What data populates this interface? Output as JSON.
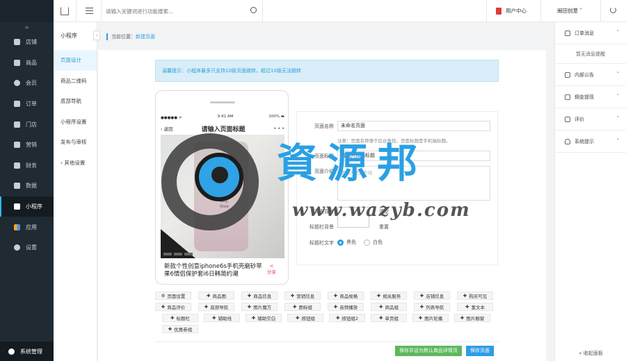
{
  "leftnav": {
    "collapse_icon": "≡",
    "items": [
      {
        "label": "店铺",
        "icon": "store-icon"
      },
      {
        "label": "商品",
        "icon": "goods-icon"
      },
      {
        "label": "会员",
        "icon": "user-icon"
      },
      {
        "label": "订单",
        "icon": "order-icon"
      },
      {
        "label": "门店",
        "icon": "shop-icon"
      },
      {
        "label": "营销",
        "icon": "marketing-icon"
      },
      {
        "label": "财务",
        "icon": "finance-icon"
      },
      {
        "label": "数据",
        "icon": "chart-icon"
      },
      {
        "label": "小程序",
        "icon": "miniapp-icon",
        "active": true
      },
      {
        "label": "应用",
        "icon": "apps-icon"
      },
      {
        "label": "设置",
        "icon": "gear-icon"
      }
    ],
    "system": "系统管理"
  },
  "topbar": {
    "search_placeholder": "请输入关键词进行功能搜索...",
    "user_center": "用户中心",
    "shop_name": "闽田创意 ˅"
  },
  "subnav": {
    "title": "小程序",
    "items": [
      "页面设计",
      "商品二维码",
      "底部导航",
      "小程序设置",
      "发布与审核",
      "› 其他设置"
    ]
  },
  "breadcrumb": {
    "prefix": "当前位置：",
    "current": "新建页面"
  },
  "tip": "温馨提示：小程序最多只支持10级页面跳转，超过10级无法跳转",
  "phone": {
    "status_left": "●●●●● ᯤ",
    "status_time": "9:41 AM",
    "status_right": "100% ▬",
    "back": "‹ 返回",
    "nav_title": "请输入页面标题",
    "more": "• • •",
    "caption": "day,\nlove",
    "product_title": "新款个性创意iphone6s手机壳磨砂苹果6情侣保护套i6日韩简约潮",
    "share": "分享"
  },
  "form": {
    "page_name_label": "页面名称",
    "page_name_value": "未命名页面",
    "page_name_note": "注意：页面名称便于后台查找，页面标题是手机端标题。",
    "page_title_label": "页面标题",
    "page_title_value": "请输入页面标题",
    "page_desc_label": "页面介绍",
    "page_desc_placeholder": "请输入页面介绍",
    "bg_color_label": "页面背景",
    "title_bg_label": "标题栏背景",
    "clear1": "清空",
    "clear2": "重置",
    "title_text_label": "标题栏文字",
    "radio_black": "黑色",
    "radio_white": "白色"
  },
  "components": [
    [
      "页面设置",
      "商品图",
      "商品信息",
      "营销信息",
      "商品规格",
      "相关服务",
      "店铺信息",
      "购买可见"
    ],
    [
      "商品评价",
      "底部导航",
      "图片魔方",
      "图标组",
      "音频播放",
      "商品组",
      "列表导航",
      "富文本"
    ],
    [
      "标题栏",
      "辅助线",
      "辅助空白",
      "按钮组",
      "按钮组2",
      "单页组",
      "图片轮播",
      "图片橱窗"
    ],
    [
      "优惠券组"
    ]
  ],
  "buttons": {
    "save_default": "保存并设为默认商品详情页",
    "save": "保存页面"
  },
  "rightpanel": {
    "sections": [
      {
        "label": "订单消息",
        "icon": "message-icon"
      },
      {
        "label": "内部公告",
        "icon": "speaker-icon"
      },
      {
        "label": "佣金提现",
        "icon": "wallet-icon"
      },
      {
        "label": "评价",
        "icon": "comment-icon"
      },
      {
        "label": "系统提示",
        "icon": "bell-icon"
      }
    ],
    "empty": "暂无消息提醒",
    "collapse": "» 收起面板"
  },
  "watermark": {
    "cn": "資源邦",
    "url": "www.wazyb.com"
  }
}
